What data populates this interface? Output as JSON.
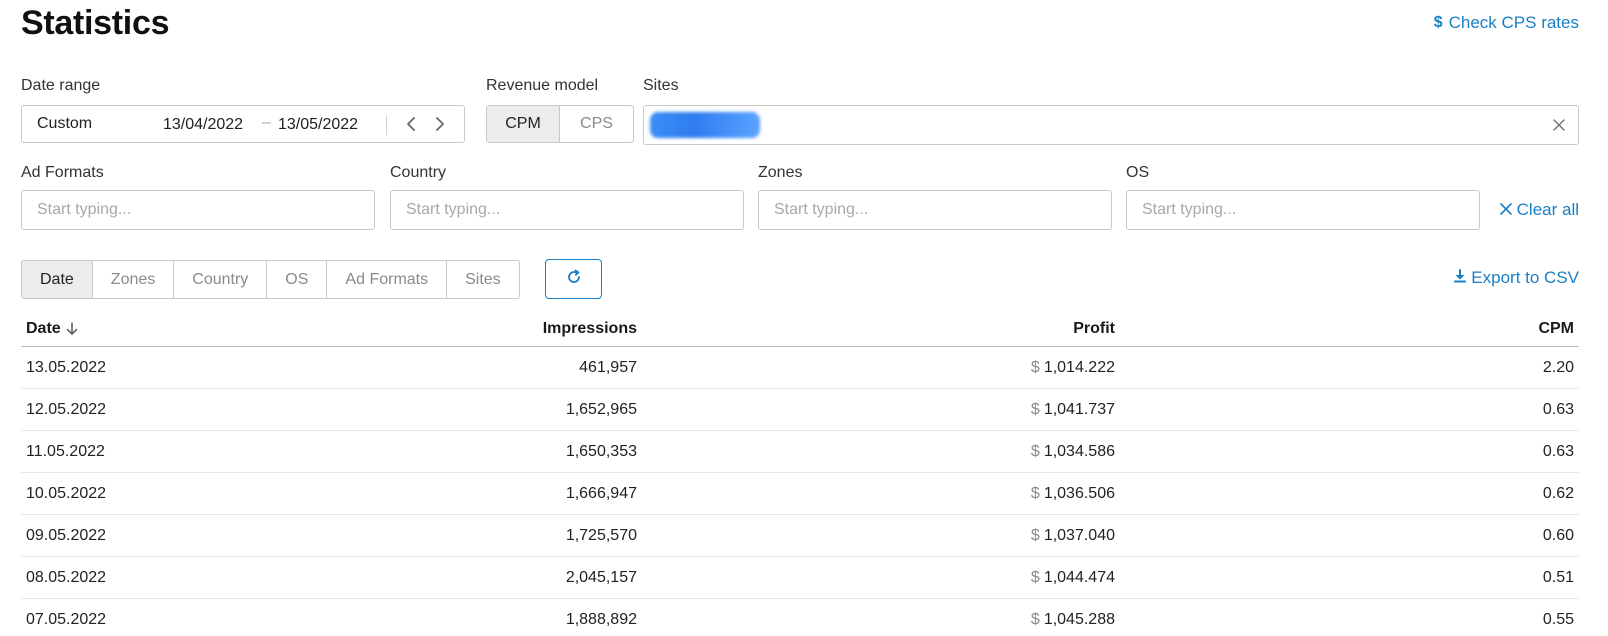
{
  "header": {
    "title": "Statistics",
    "check_rates_link": "Check CPS rates"
  },
  "filters": {
    "date_range": {
      "label": "Date range",
      "preset": "Custom",
      "from": "13/04/2022",
      "separator": "–",
      "to": "13/05/2022"
    },
    "revenue_model": {
      "label": "Revenue model",
      "options": [
        "CPM",
        "CPS"
      ],
      "selected": "CPM"
    },
    "sites": {
      "label": "Sites"
    },
    "ad_formats": {
      "label": "Ad Formats",
      "placeholder": "Start typing..."
    },
    "country": {
      "label": "Country",
      "placeholder": "Start typing..."
    },
    "zones": {
      "label": "Zones",
      "placeholder": "Start typing..."
    },
    "os": {
      "label": "OS",
      "placeholder": "Start typing..."
    },
    "clear_all": "Clear all"
  },
  "group_by": {
    "tabs": [
      "Date",
      "Zones",
      "Country",
      "OS",
      "Ad Formats",
      "Sites"
    ],
    "selected": "Date"
  },
  "export_label": "Export to CSV",
  "table": {
    "columns": [
      "Date",
      "Impressions",
      "Profit",
      "CPM"
    ],
    "currency_symbol": "$",
    "rows": [
      {
        "date": "13.05.2022",
        "impressions": "461,957",
        "profit": "1,014.222",
        "cpm": "2.20"
      },
      {
        "date": "12.05.2022",
        "impressions": "1,652,965",
        "profit": "1,041.737",
        "cpm": "0.63"
      },
      {
        "date": "11.05.2022",
        "impressions": "1,650,353",
        "profit": "1,034.586",
        "cpm": "0.63"
      },
      {
        "date": "10.05.2022",
        "impressions": "1,666,947",
        "profit": "1,036.506",
        "cpm": "0.62"
      },
      {
        "date": "09.05.2022",
        "impressions": "1,725,570",
        "profit": "1,037.040",
        "cpm": "0.60"
      },
      {
        "date": "08.05.2022",
        "impressions": "2,045,157",
        "profit": "1,044.474",
        "cpm": "0.51"
      },
      {
        "date": "07.05.2022",
        "impressions": "1,888,892",
        "profit": "1,045.288",
        "cpm": "0.55"
      }
    ]
  },
  "colors": {
    "accent": "#1a7fc4",
    "active_segment_bg": "#ececec",
    "border": "#c9c9c9"
  },
  "icons": {
    "check_rates": "dollar-icon",
    "date_prev": "chevron-left-icon",
    "date_next": "chevron-right-icon",
    "sites_clear": "close-icon",
    "clear_all": "close-icon",
    "refresh": "refresh-icon",
    "export": "download-icon",
    "sort": "arrow-down-icon"
  }
}
